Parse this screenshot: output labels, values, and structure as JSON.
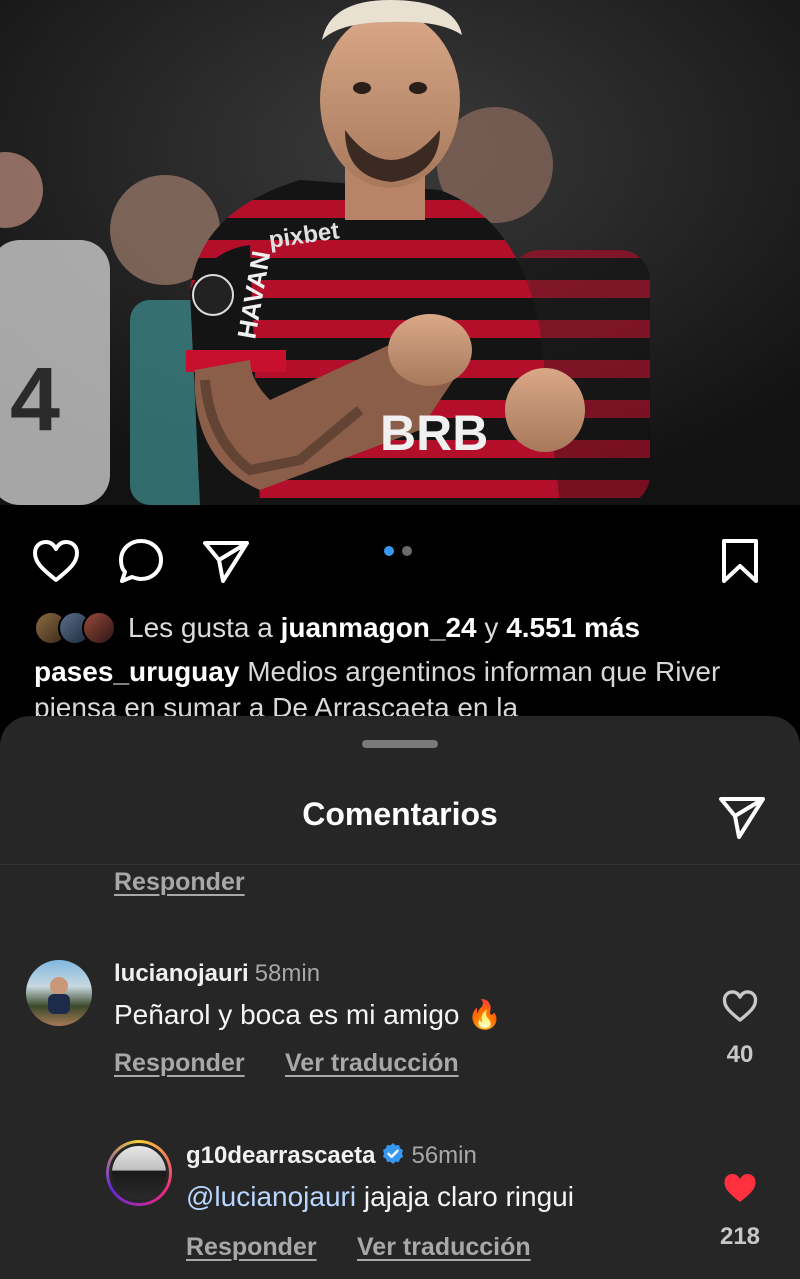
{
  "post": {
    "likes_prefix": "Les gusta a ",
    "likes_user": "juanmagon_24",
    "likes_joiner": " y ",
    "likes_count": "4.551 más",
    "caption_user": "pases_uruguay",
    "caption_text": "Medios argentinos informan que River piensa en sumar a De Arrascaeta en la",
    "carousel": {
      "total": 2,
      "active": 1
    }
  },
  "jersey": {
    "sponsor_sleeve": "HAVAN",
    "sponsor_chest": "BRB",
    "sponsor_top": "pixbet"
  },
  "sheet": {
    "title": "Comentarios",
    "prev_reply_label": "Responder"
  },
  "comments": [
    {
      "username": "lucianojauri",
      "time": "58min",
      "text": "Peñarol y boca es mi amigo 🔥",
      "reply_label": "Responder",
      "translate_label": "Ver traducción",
      "likes": "40",
      "liked": false
    },
    {
      "username": "g10dearrascaeta",
      "verified": true,
      "time": "56min",
      "mention": "@lucianojauri",
      "text": " jajaja claro ringui",
      "reply_label": "Responder",
      "translate_label": "Ver traducción",
      "likes": "218",
      "liked": true
    }
  ],
  "colors": {
    "sheet_bg": "#262626",
    "like_red": "#ff3040",
    "active_dot": "#3897f0",
    "verified_blue": "#3897f0",
    "jersey_red": "#c8102e",
    "jersey_black": "#141414"
  }
}
